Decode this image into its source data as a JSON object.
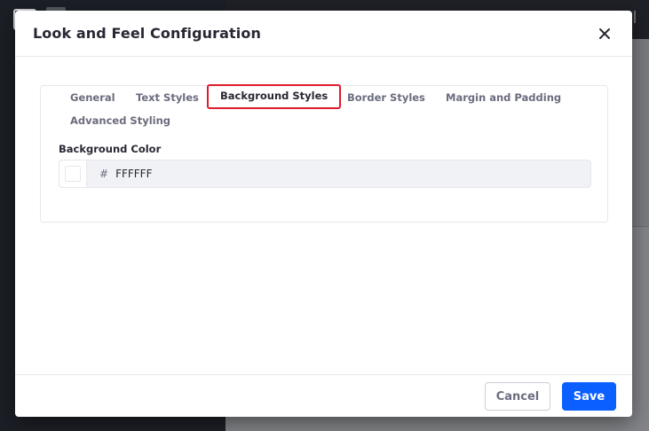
{
  "modal": {
    "title": "Look and Feel Configuration"
  },
  "tabs": [
    {
      "label": "General",
      "active": false
    },
    {
      "label": "Text Styles",
      "active": false
    },
    {
      "label": "Background Styles",
      "active": true
    },
    {
      "label": "Border Styles",
      "active": false
    },
    {
      "label": "Margin and Padding",
      "active": false
    },
    {
      "label": "Advanced Styling",
      "active": false
    }
  ],
  "background_color": {
    "label": "Background Color",
    "prefix": "#",
    "value": "FFFFFF"
  },
  "footer": {
    "cancel_label": "Cancel",
    "save_label": "Save"
  },
  "colors": {
    "primary": "#0b5fff",
    "active_tab_outline": "#e01b2c"
  },
  "icons": {
    "close": "close-icon"
  }
}
